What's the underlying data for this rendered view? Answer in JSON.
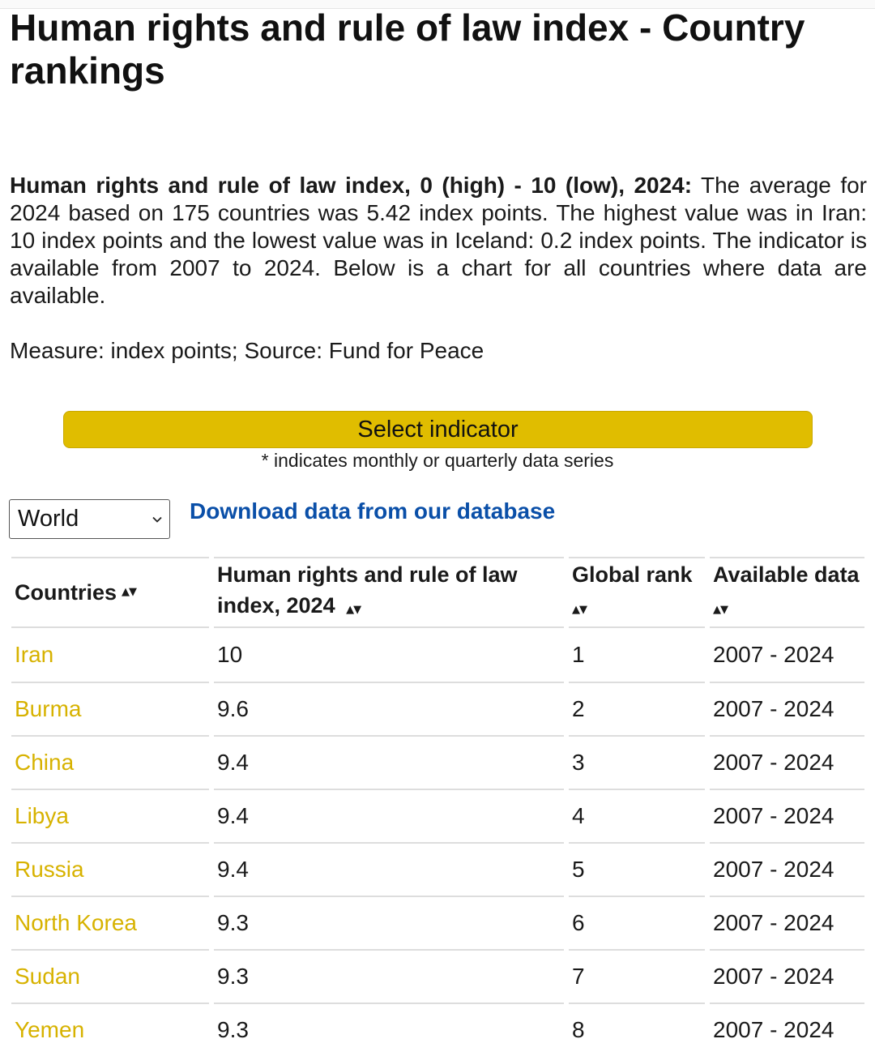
{
  "page": {
    "title": "Human rights and rule of law index - Country rankings",
    "intro_bold": "Human rights and rule of law index, 0 (high) - 10 (low), 2024:",
    "intro_text": " The average for 2024 based on 175 countries was 5.42 index points. The highest value was in Iran: 10 index points and the lowest value was in Iceland: 0.2 index points. The indicator is available from 2007 to 2024. Below is a chart for all countries where data are available.",
    "measure": "Measure: index points; Source: Fund for Peace"
  },
  "controls": {
    "select_indicator_label": "Select indicator",
    "note": "* indicates monthly or quarterly data series",
    "region_value": "World",
    "download_link": "Download data from our database"
  },
  "table": {
    "headers": {
      "countries": "Countries",
      "index_line1": "Human rights and rule of law",
      "index_line2": "index, 2024",
      "rank": "Global rank",
      "available": "Available data"
    },
    "rows": [
      {
        "country": "Iran",
        "value": "10",
        "rank": "1",
        "available": "2007 - 2024"
      },
      {
        "country": "Burma",
        "value": "9.6",
        "rank": "2",
        "available": "2007 - 2024"
      },
      {
        "country": "China",
        "value": "9.4",
        "rank": "3",
        "available": "2007 - 2024"
      },
      {
        "country": "Libya",
        "value": "9.4",
        "rank": "4",
        "available": "2007 - 2024"
      },
      {
        "country": "Russia",
        "value": "9.4",
        "rank": "5",
        "available": "2007 - 2024"
      },
      {
        "country": "North Korea",
        "value": "9.3",
        "rank": "6",
        "available": "2007 - 2024"
      },
      {
        "country": "Sudan",
        "value": "9.3",
        "rank": "7",
        "available": "2007 - 2024"
      },
      {
        "country": "Yemen",
        "value": "9.3",
        "rank": "8",
        "available": "2007 - 2024"
      }
    ]
  },
  "colors": {
    "accent_yellow": "#e0bd00",
    "country_link": "#d7b200",
    "download_link": "#0a4fa8"
  },
  "icons": {
    "sort": "sort-arrows-icon",
    "dropdown": "chevron-down-icon"
  }
}
